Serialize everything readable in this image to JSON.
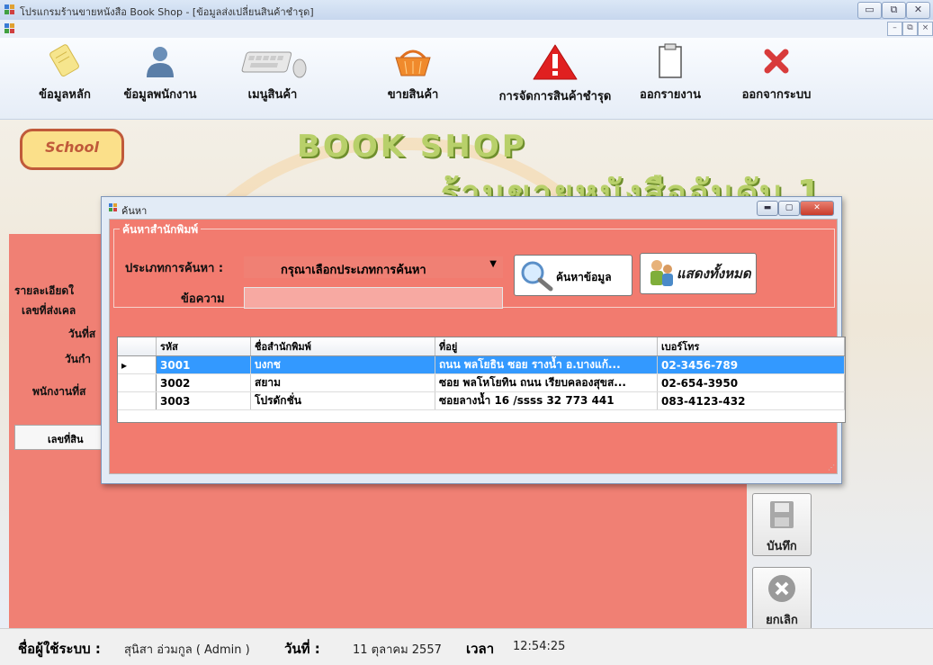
{
  "window": {
    "title": "โปรแกรมร้านขายหนังสือ Book Shop - [ข้อมูลส่งเปลี่ยนสินค้าชำรุด]"
  },
  "toolbar": {
    "items": [
      {
        "label": "ข้อมูลหลัก",
        "icon": "notepad-icon"
      },
      {
        "label": "ข้อมูลพนักงาน",
        "icon": "user-icon"
      },
      {
        "label": "เมนูสินค้า",
        "icon": "keyboard-mouse-icon"
      },
      {
        "label": "ขายสินค้า",
        "icon": "basket-icon"
      },
      {
        "label": "การจัดการสินค้าชำรุด",
        "icon": "warning-icon"
      },
      {
        "label": "ออกรายงาน",
        "icon": "clipboard-icon"
      },
      {
        "label": "ออกจากระบบ",
        "icon": "close-icon"
      }
    ]
  },
  "banner": {
    "title_en": "BOOK SHOP",
    "title_th": "ร้านขายหนังสืออันดับ 1",
    "sign": "School"
  },
  "mainform": {
    "section_label": "รายละเอียดใ",
    "field1": "เลขที่ส่งเคล",
    "field2": "วันที่ส",
    "field3": "วันกำ",
    "field4": "พนักงานที่ส",
    "grid_header": "เลขที่สิน",
    "save_label": "บันทึก",
    "cancel_label": "ยกเลิก"
  },
  "dialog": {
    "title": "ค้นหา",
    "group_title": "ค้นหาสำนักพิมพ์",
    "search_type_label": "ประเภทการค้นหา :",
    "search_type_value": "กรุณาเลือกประเภทการค้นหา",
    "text_label": "ข้อความ",
    "text_value": "",
    "search_button": "ค้นหาข้อมูล",
    "show_all_button": "แสดงทั้งหมด",
    "columns": [
      "รหัส",
      "ชื่อสำนักพิมพ์",
      "ที่อยู่",
      "เบอร์โทร"
    ],
    "rows": [
      [
        "3001",
        "บงกช",
        "ถนน พลโยธิน ซอย รางน้ำ อ.บางแก้...",
        "02-3456-789"
      ],
      [
        "3002",
        "สยาม",
        "ซอย พลโหโยทิน ถนน เรียบคลองสุขส...",
        "02-654-3950"
      ],
      [
        "3003",
        "โปรดักชั่น",
        "ซอยลางน้ำ 16 /ssss 32 773 441",
        "083-4123-432"
      ]
    ],
    "selected_row": 0
  },
  "status": {
    "user_label": "ชื่อผู้ใช้ระบบ :",
    "user_value": "สุนิสา อ่วมกูล ( Admin )",
    "date_label": "วันที่ :",
    "date_value": "11 ตุลาคม 2557",
    "time_label": "เวลา",
    "time_value": "12:54:25"
  },
  "colors": {
    "form_bg": "#f27b6f",
    "selection": "#3399ff",
    "banner_text": "#b8d06a"
  }
}
